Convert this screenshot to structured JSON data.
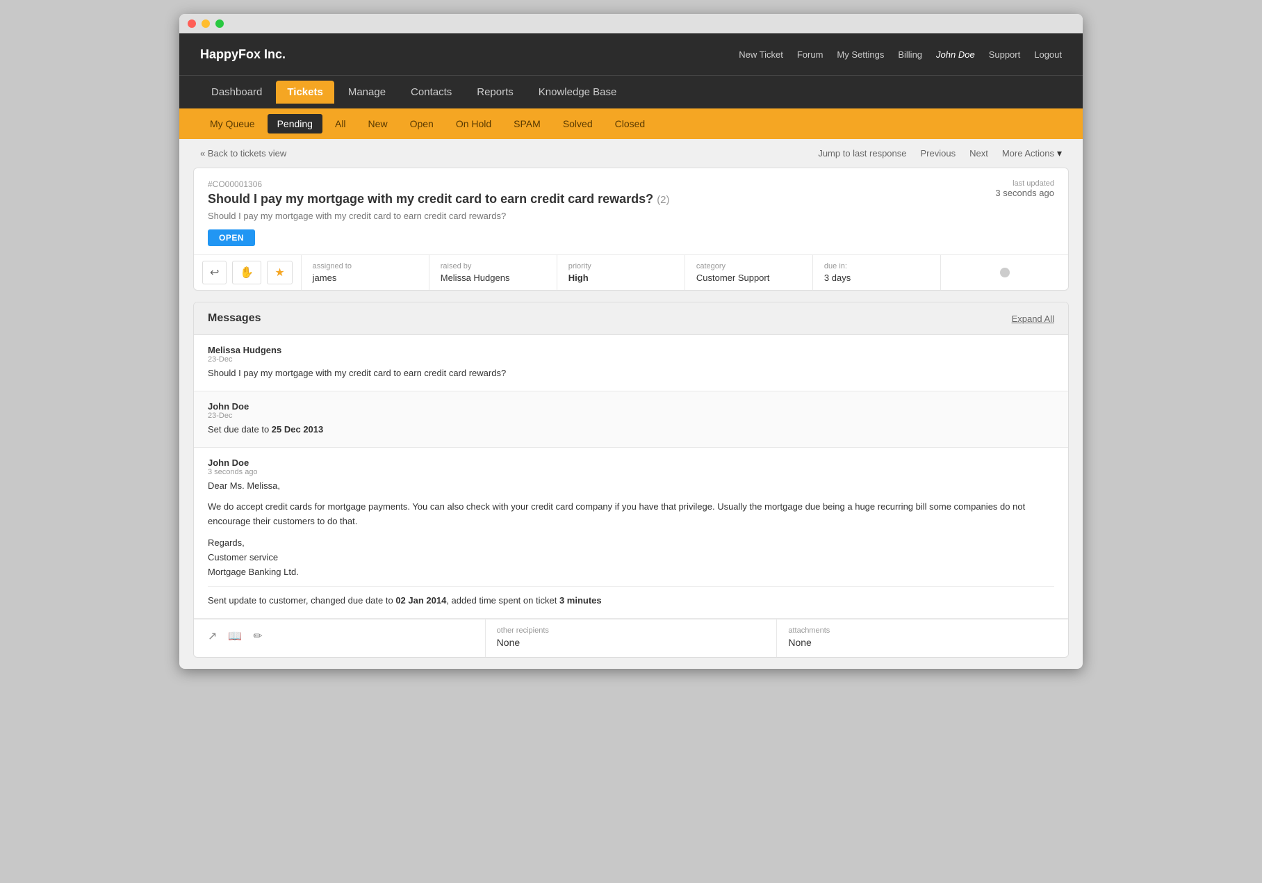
{
  "window": {
    "title": "HappyFox Inc."
  },
  "top_nav": {
    "logo": "HappyFox Inc.",
    "links": [
      {
        "label": "New Ticket",
        "name": "new-ticket-link"
      },
      {
        "label": "Forum",
        "name": "forum-link"
      },
      {
        "label": "My Settings",
        "name": "my-settings-link"
      },
      {
        "label": "Billing",
        "name": "billing-link"
      },
      {
        "label": "John Doe",
        "name": "user-name-link",
        "is_user": true
      },
      {
        "label": "Support",
        "name": "support-link"
      },
      {
        "label": "Logout",
        "name": "logout-link"
      }
    ]
  },
  "main_nav": {
    "items": [
      {
        "label": "Dashboard",
        "name": "dashboard-nav",
        "active": false
      },
      {
        "label": "Tickets",
        "name": "tickets-nav",
        "active": true
      },
      {
        "label": "Manage",
        "name": "manage-nav",
        "active": false
      },
      {
        "label": "Contacts",
        "name": "contacts-nav",
        "active": false
      },
      {
        "label": "Reports",
        "name": "reports-nav",
        "active": false
      },
      {
        "label": "Knowledge Base",
        "name": "knowledge-base-nav",
        "active": false
      }
    ]
  },
  "sub_nav": {
    "items": [
      {
        "label": "My Queue",
        "name": "my-queue-tab",
        "active": false
      },
      {
        "label": "Pending",
        "name": "pending-tab",
        "active": true
      },
      {
        "label": "All",
        "name": "all-tab",
        "active": false
      },
      {
        "label": "New",
        "name": "new-tab",
        "active": false
      },
      {
        "label": "Open",
        "name": "open-tab",
        "active": false
      },
      {
        "label": "On Hold",
        "name": "on-hold-tab",
        "active": false
      },
      {
        "label": "SPAM",
        "name": "spam-tab",
        "active": false
      },
      {
        "label": "Solved",
        "name": "solved-tab",
        "active": false
      },
      {
        "label": "Closed",
        "name": "closed-tab",
        "active": false
      }
    ]
  },
  "breadcrumb": {
    "back_label": "« Back to tickets view",
    "actions": [
      {
        "label": "Jump to last response",
        "name": "jump-to-last-response"
      },
      {
        "label": "Previous",
        "name": "previous-action"
      },
      {
        "label": "Next",
        "name": "next-action"
      },
      {
        "label": "More Actions",
        "name": "more-actions-dropdown"
      }
    ]
  },
  "ticket": {
    "number": "#CO00001306",
    "title": "Should I pay my mortgage with my credit card to earn credit card rewards?",
    "count": "(2)",
    "subtitle": "Should I pay my mortgage with my credit card to earn credit card rewards?",
    "status": "OPEN",
    "last_updated_label": "last updated",
    "last_updated_value": "3 seconds ago",
    "fields": [
      {
        "label": "assigned to",
        "value": "james",
        "bold": false
      },
      {
        "label": "raised by",
        "value": "Melissa Hudgens",
        "bold": false
      },
      {
        "label": "priority",
        "value": "High",
        "bold": true
      },
      {
        "label": "category",
        "value": "Customer Support",
        "bold": false
      },
      {
        "label": "due in:",
        "value": "3 days",
        "bold": false
      }
    ],
    "action_buttons": [
      {
        "icon": "↩",
        "name": "reply-btn",
        "label": "Reply"
      },
      {
        "icon": "✋",
        "name": "hold-btn",
        "label": "Hold"
      },
      {
        "icon": "★",
        "name": "star-btn",
        "label": "Star",
        "star": true
      }
    ]
  },
  "messages": {
    "section_title": "Messages",
    "expand_all_label": "Expand All",
    "items": [
      {
        "sender": "Melissa Hudgens",
        "date": "23-Dec",
        "body": "Should I pay my mortgage with my credit card to earn credit card rewards?",
        "bold_parts": []
      },
      {
        "sender": "John Doe",
        "date": "23-Dec",
        "body": "Set due date to **25 Dec 2013**",
        "plain": "Set due date to ",
        "bold": "25 Dec 2013"
      },
      {
        "sender": "John Doe",
        "date": "3 seconds ago",
        "body_paragraphs": [
          "Dear Ms. Melissa,",
          "We do accept credit cards for mortgage payments. You can also check with your credit card company if you have that privilege. Usually the mortgage due being a huge recurring bill some companies do not encourage their customers to do that.",
          "Regards,\nCustomer service\nMortgage Banking Ltd."
        ],
        "footer_note_plain": "Sent update to customer, changed due date to ",
        "footer_note_bold": "02 Jan 2014",
        "footer_note_end_plain": ", added time spent on ticket ",
        "footer_note_end_bold": "3 minutes"
      }
    ],
    "footer": {
      "other_recipients_label": "other recipients",
      "other_recipients_value": "None",
      "attachments_label": "attachments",
      "attachments_value": "None",
      "icons": [
        {
          "icon": "↗",
          "name": "share-icon"
        },
        {
          "icon": "📖",
          "name": "kb-icon"
        },
        {
          "icon": "✏",
          "name": "edit-icon"
        }
      ]
    }
  }
}
